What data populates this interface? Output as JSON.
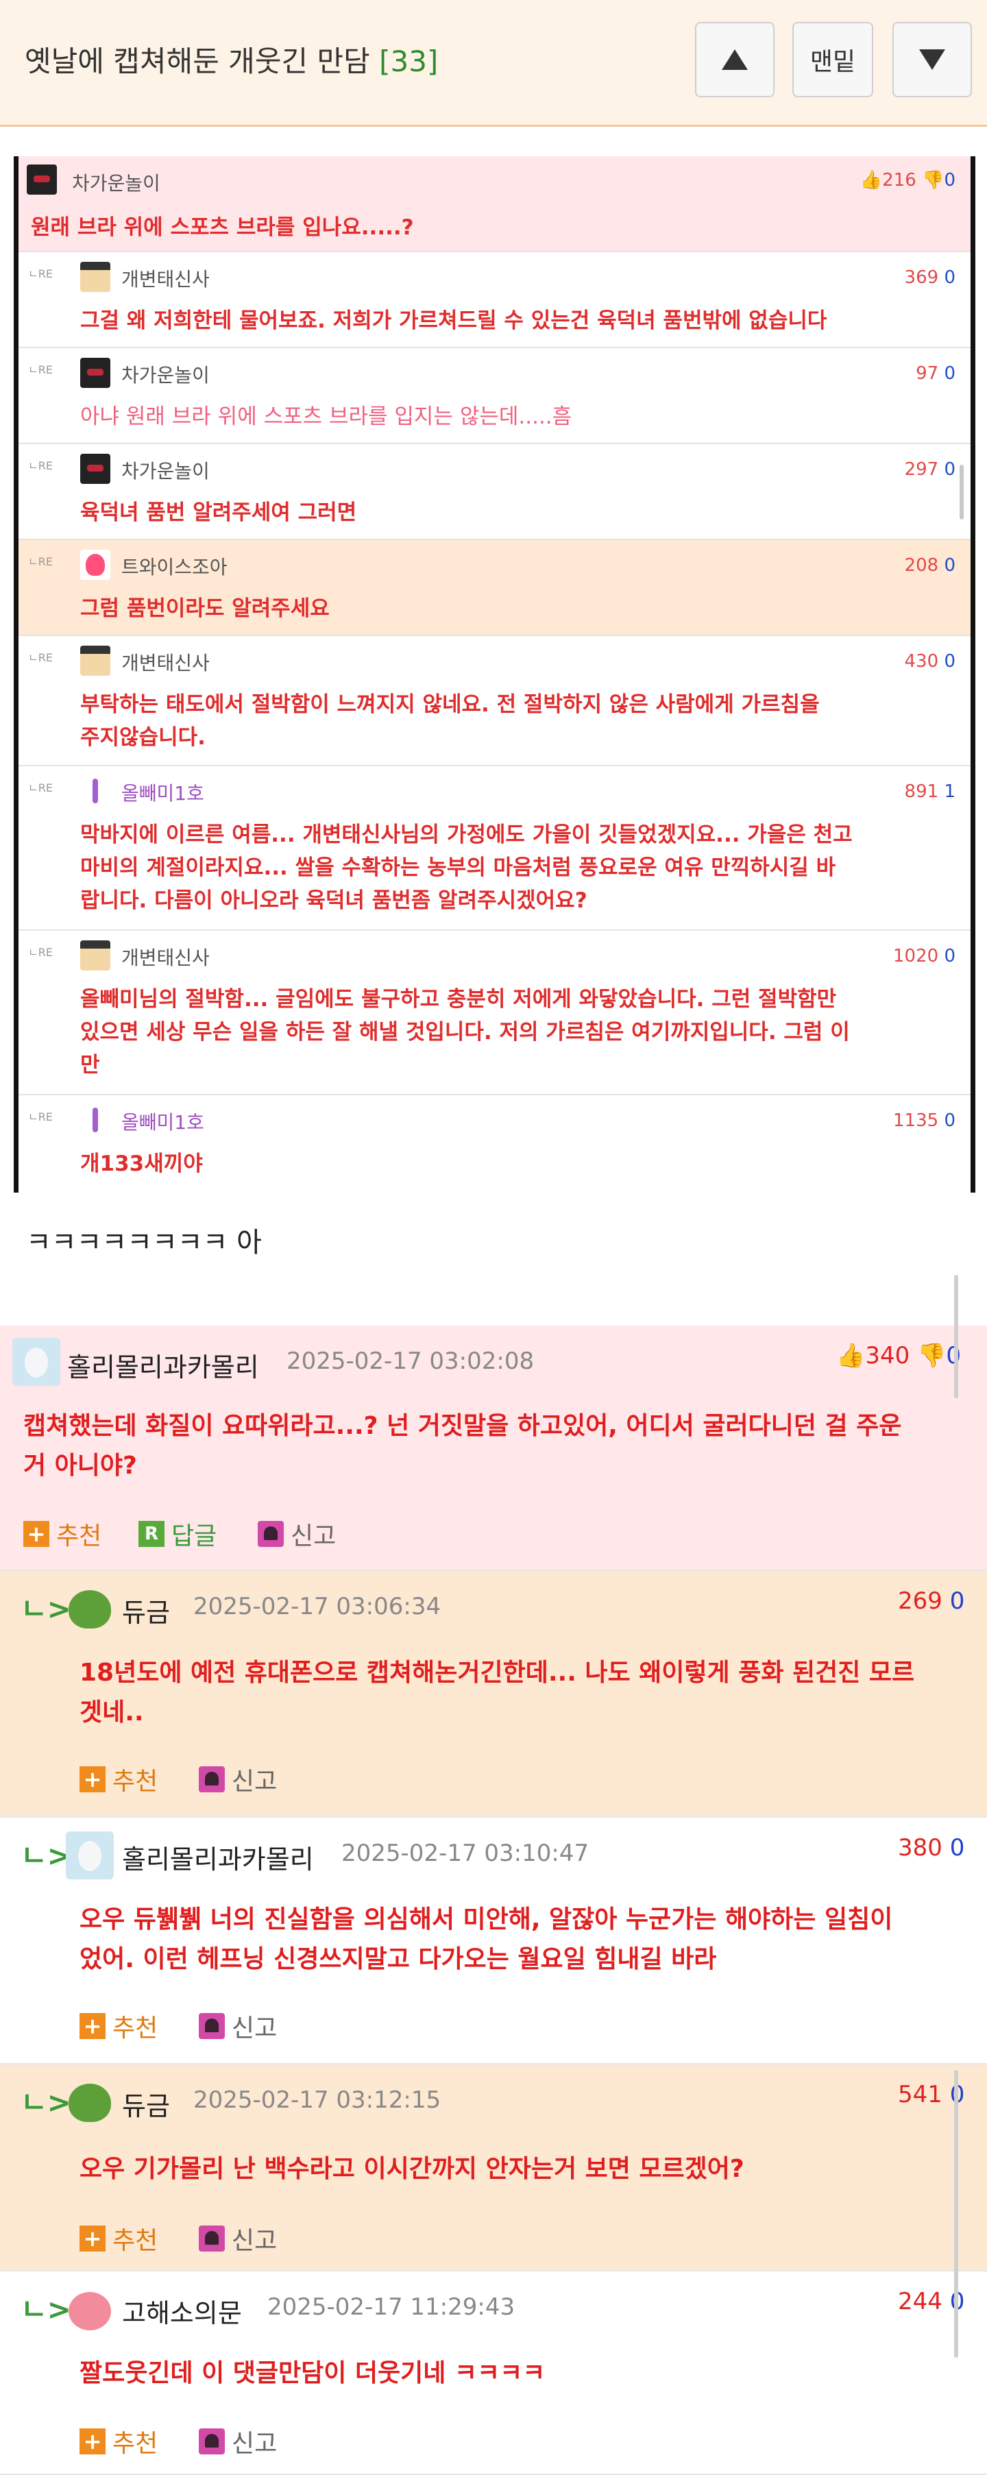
{
  "header": {
    "title": "옛날에 캡쳐해둔 개웃긴 만담",
    "count": "[33]",
    "up_label": "▲",
    "bottom_label": "맨밑",
    "down_label": "▼"
  },
  "screenshot": {
    "rows": [
      {
        "name": "차가운놀이",
        "num_up": "216",
        "num_down": "0",
        "text": "원래 브라 위에 스포츠 브라를 입나요.....?"
      },
      {
        "name": "개변태신사",
        "num_up": "369",
        "num_down": "0",
        "text": "그걸 왜 저희한테 물어보죠. 저희가 가르쳐드릴 수 있는건 육덕녀 품번밖에 없습니다"
      },
      {
        "name": "차가운놀이",
        "num_up": "97",
        "num_down": "0",
        "text": "아냐 원래 브라 위에 스포츠 브라를 입지는 않는데.....흠"
      },
      {
        "name": "차가운놀이",
        "num_up": "297",
        "num_down": "0",
        "text": "육덕녀 품번 알려주세여 그러면"
      },
      {
        "name": "트와이스조아",
        "num_up": "208",
        "num_down": "0",
        "text": "그럼 품번이라도 알려주세요"
      },
      {
        "name": "개변태신사",
        "num_up": "430",
        "num_down": "0",
        "text1": "부탁하는 태도에서 절박함이 느껴지지 않네요. 전 절박하지 않은 사람에게 가르침을",
        "text2": "주지않습니다."
      },
      {
        "name": "올빼미1호",
        "num_up": "891",
        "num_down": "1",
        "text1": "막바지에 이르른 여름... 개변태신사님의 가정에도 가을이 깃들었겠지요... 가을은 천고",
        "text2": "마비의 계절이라지요... 쌀을 수확하는 농부의 마음처럼 풍요로운 여유 만끽하시길 바",
        "text3": "랍니다. 다름이 아니오라 육덕녀 품번좀 알려주시겠어요?"
      },
      {
        "name": "개변태신사",
        "num_up": "1020",
        "num_down": "0",
        "text1": "올빼미님의 절박함... 글임에도 불구하고 충분히 저에게 와닿았습니다. 그런 절박함만",
        "text2": "있으면 세상 무슨 일을 하든 잘 해낼 것입니다. 저의 가르침은 여기까지입니다. 그럼 이",
        "text3": "만"
      },
      {
        "name": "올빼미1호",
        "num_up": "1135",
        "num_down": "0",
        "text": "개133새끼야"
      }
    ],
    "re_label": "ㄴRE"
  },
  "caption": "ㅋㅋㅋㅋㅋㅋㅋㅋ 아",
  "comments": [
    {
      "nick": "홀리몰리과카몰리",
      "date": "2025-02-17 03:02:08",
      "up": "340",
      "down": "0",
      "text1": "캡쳐했는데 화질이 요따위라고...? 넌 거짓말을 하고있어, 어디서 굴러다니던 걸 주운",
      "text2": "거 아니야?",
      "recommend": "추천",
      "reply": "답글",
      "report": "신고",
      "reply_icon": "R"
    },
    {
      "nick": "듀금",
      "date": "2025-02-17 03:06:34",
      "up": "269",
      "down": "0",
      "text1": "18년도에 예전 휴대폰으로 캡쳐해논거긴한데... 나도 왜이렇게 풍화 된건진 모르",
      "text2": "겟네..",
      "recommend": "추천",
      "report": "신고"
    },
    {
      "nick": "홀리몰리과카몰리",
      "date": "2025-02-17 03:10:47",
      "up": "380",
      "down": "0",
      "text1": "오우 듀뷁뷁 너의 진실함을 의심해서 미안해, 알잖아 누군가는 해야하는 일침이",
      "text2": "었어. 이런 헤프닝 신경쓰지말고 다가오는 월요일 힘내길 바라",
      "recommend": "추천",
      "report": "신고"
    },
    {
      "nick": "듀금",
      "date": "2025-02-17 03:12:15",
      "up": "541",
      "down": "0",
      "text1": "오우 기가몰리 난 백수라고 이시간까지 안자는거 보면 모르겠어?",
      "recommend": "추천",
      "report": "신고"
    },
    {
      "nick": "고해소의문",
      "date": "2025-02-17 11:29:43",
      "up": "244",
      "down": "0",
      "text1": "짤도웃긴데 이 댓글만담이 더웃기네 ㅋㅋㅋㅋ",
      "recommend": "추천",
      "report": "신고"
    }
  ],
  "reply_arrow": "ㄴ>"
}
